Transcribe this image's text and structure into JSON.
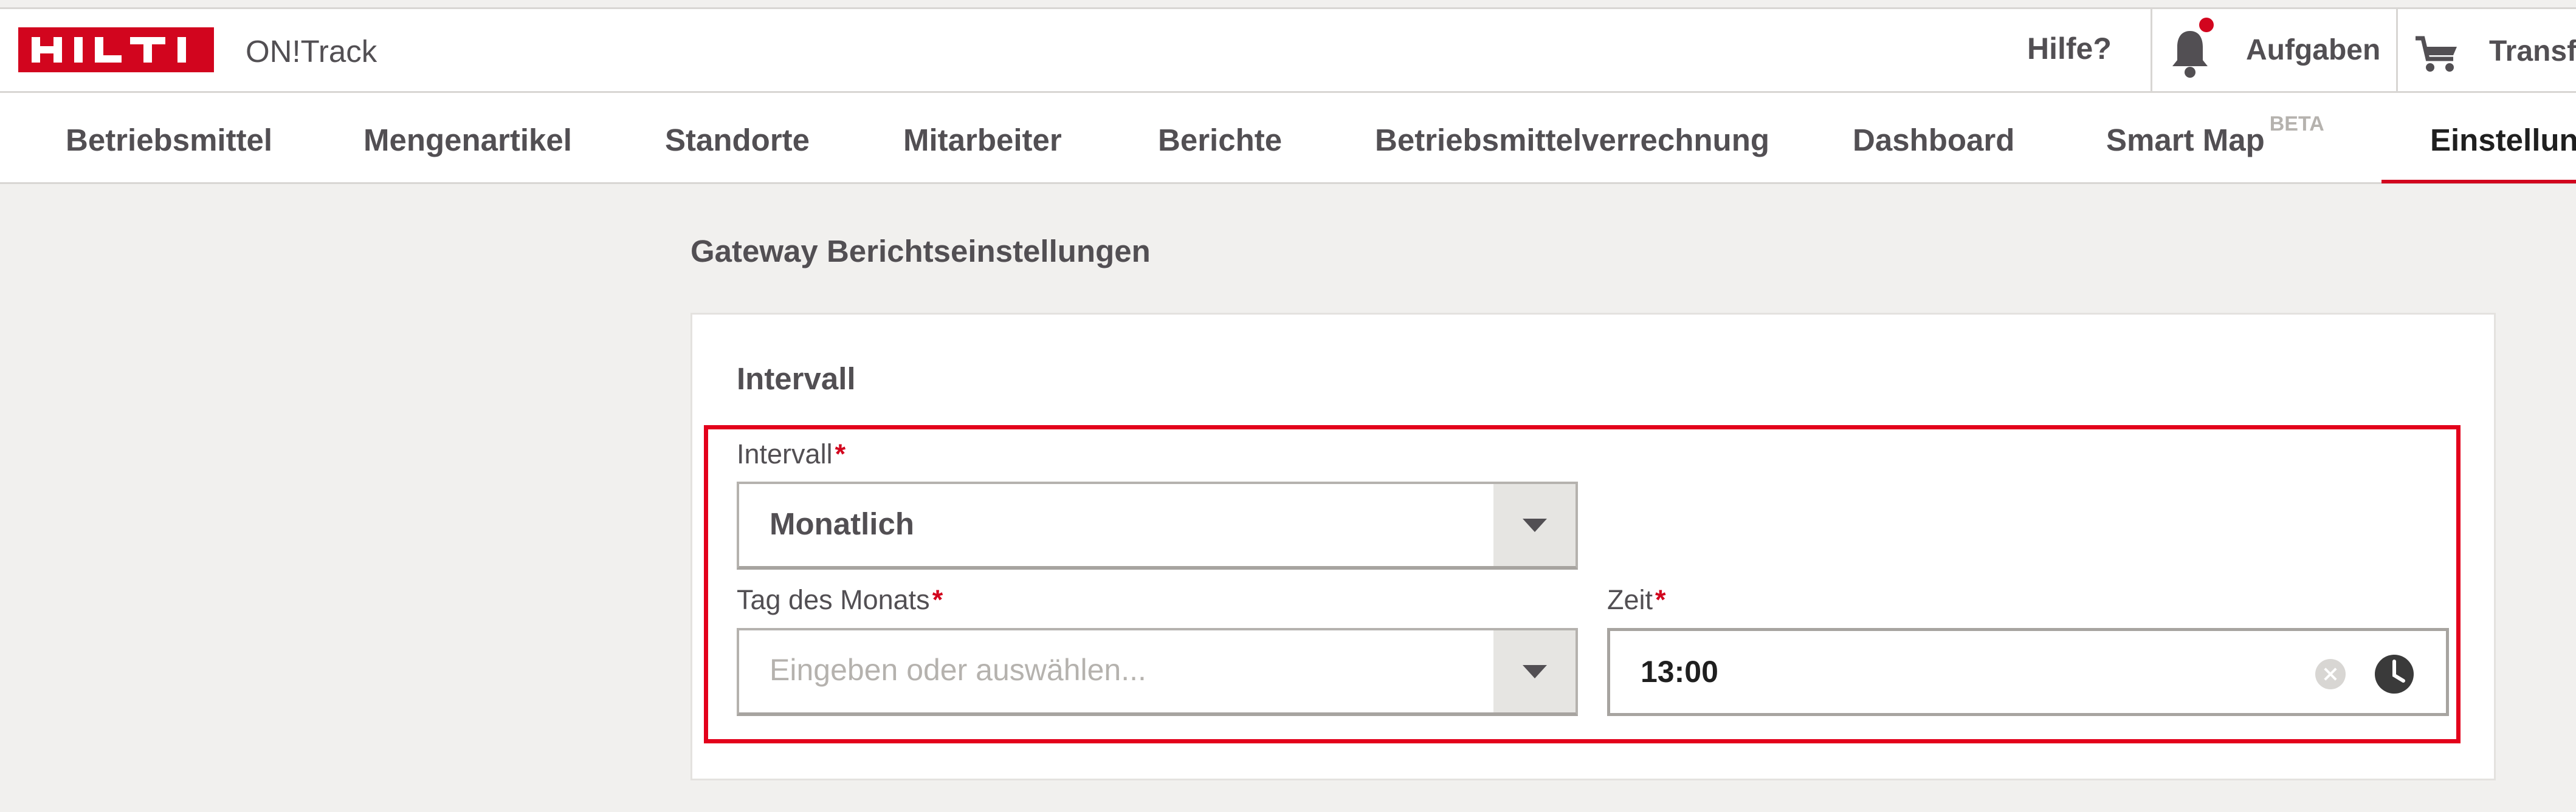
{
  "header": {
    "logo_text": "HILTI",
    "app_name": "ON!Track",
    "help": "Hilfe?",
    "tasks": "Aufgaben",
    "transfer": "Transfer"
  },
  "nav": {
    "items": [
      "Betriebsmittel",
      "Mengenartikel",
      "Standorte",
      "Mitarbeiter",
      "Berichte",
      "Betriebsmittelverrechnung",
      "Dashboard",
      "Smart Map",
      "Einstellungen"
    ],
    "beta_badge": "BETA",
    "active": "Einstellungen"
  },
  "page": {
    "title": "Gateway Berichtseinstellungen"
  },
  "card": {
    "section_title": "Intervall",
    "interval": {
      "label": "Intervall",
      "required": "*",
      "value": "Monatlich"
    },
    "day_of_month": {
      "label": "Tag des Monats",
      "required": "*",
      "placeholder": "Eingeben oder auswählen..."
    },
    "time": {
      "label": "Zeit",
      "required": "*",
      "value": "13:00"
    }
  },
  "colors": {
    "brand_red": "#d2051e",
    "highlight_red": "#e3001b",
    "text": "#524f53",
    "background": "#f1f0ee"
  },
  "icons": [
    "bell-icon",
    "cart-icon",
    "chevron-down-icon",
    "clear-icon",
    "clock-icon"
  ]
}
